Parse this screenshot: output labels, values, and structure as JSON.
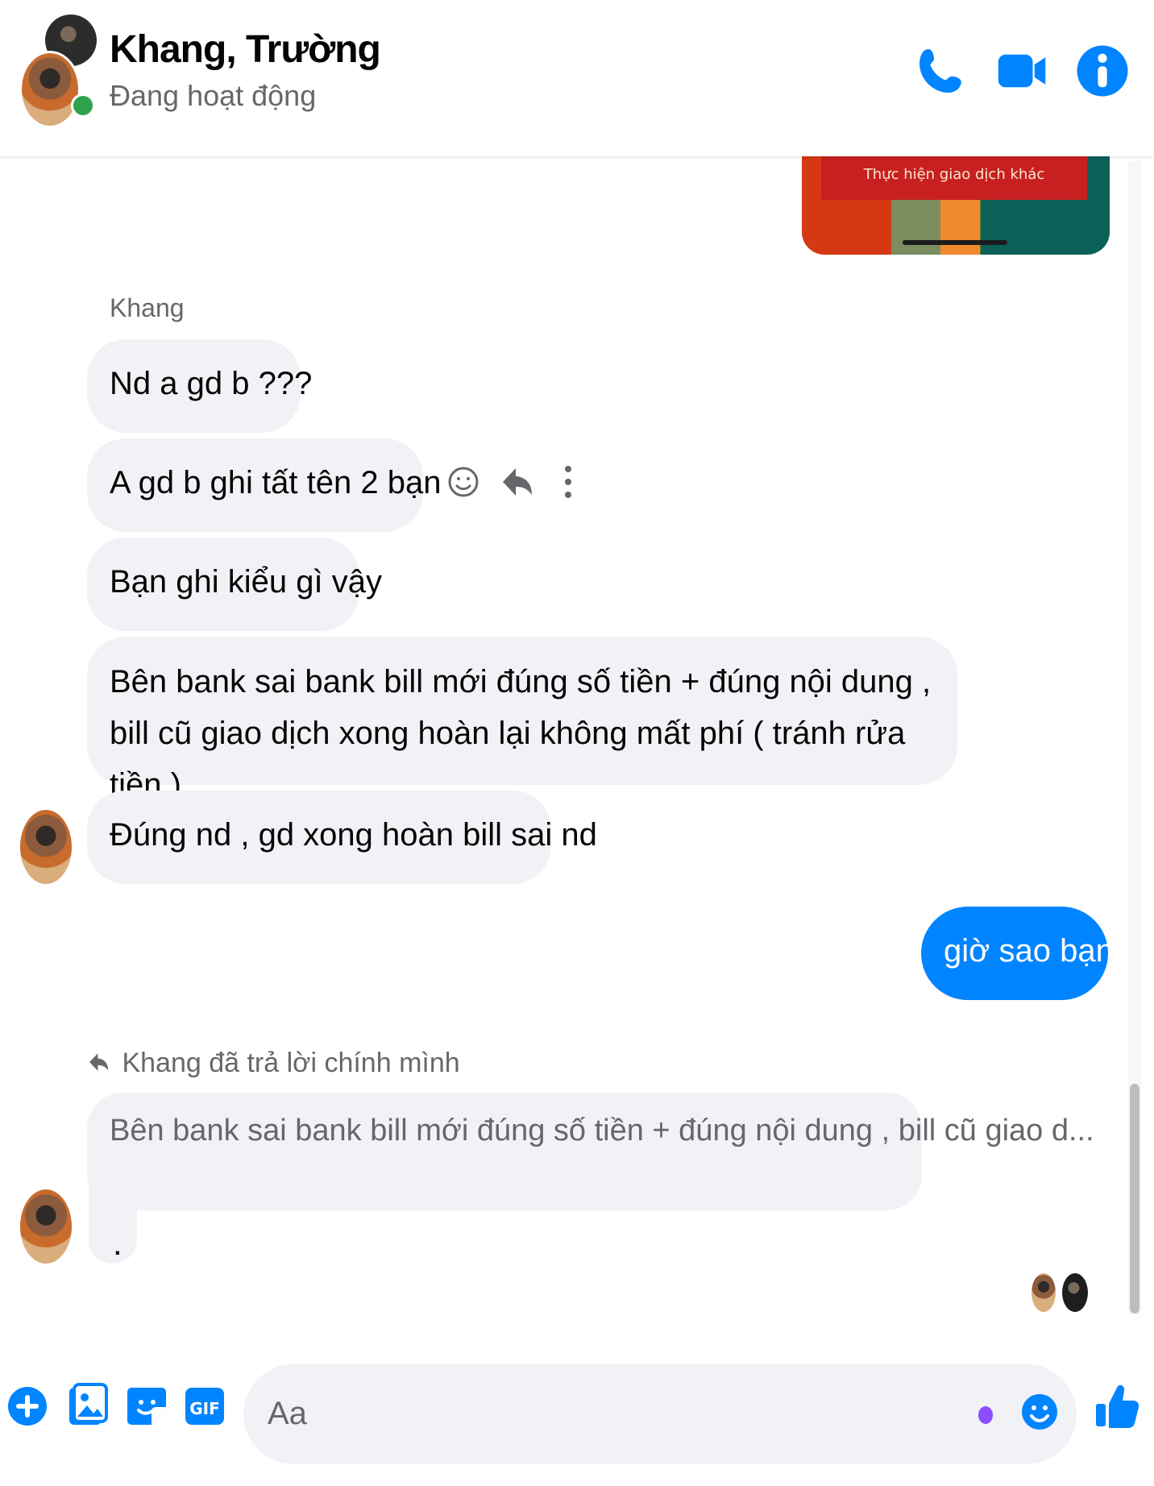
{
  "header": {
    "contact_name": "Khang, Trường",
    "status": "Đang hoạt động",
    "icons": [
      "phone-icon",
      "video-camera-icon",
      "info-icon"
    ]
  },
  "shared_card": {
    "banner_text": "Thực hiện giao dịch khác"
  },
  "conversation": {
    "sender_name": "Khang",
    "messages": [
      {
        "text": "Nd a gd b ???"
      },
      {
        "text": "A gd b ghi tất tên 2 bạn"
      },
      {
        "text": "Bạn ghi kiểu gì vậy"
      },
      {
        "text": "Bên bank sai bank bill mới đúng số tiền + đúng nội dung , bill cũ giao dịch xong hoàn lại không mất phí ( tránh rửa tiền )"
      },
      {
        "text": "Đúng nd , gd xong hoàn bill sai nd"
      },
      {
        "text": "giờ sao bạn"
      }
    ],
    "reply_header": "Khang đã trả lời chính mình",
    "quoted_text": "Bên bank sai bank bill mới đúng số tiền + đúng nội dung , bill cũ giao d...",
    "reply_text": "."
  },
  "composer": {
    "placeholder": "Aa",
    "icons": [
      "add-icon",
      "photo-icon",
      "sticker-icon",
      "gif-icon",
      "emoji-icon",
      "like-icon"
    ],
    "gif_label": "GIF"
  },
  "colors": {
    "accent": "#0084ff",
    "incoming_bubble": "#f0f2f5",
    "online": "#31a24c",
    "muted_text": "#65676b"
  }
}
